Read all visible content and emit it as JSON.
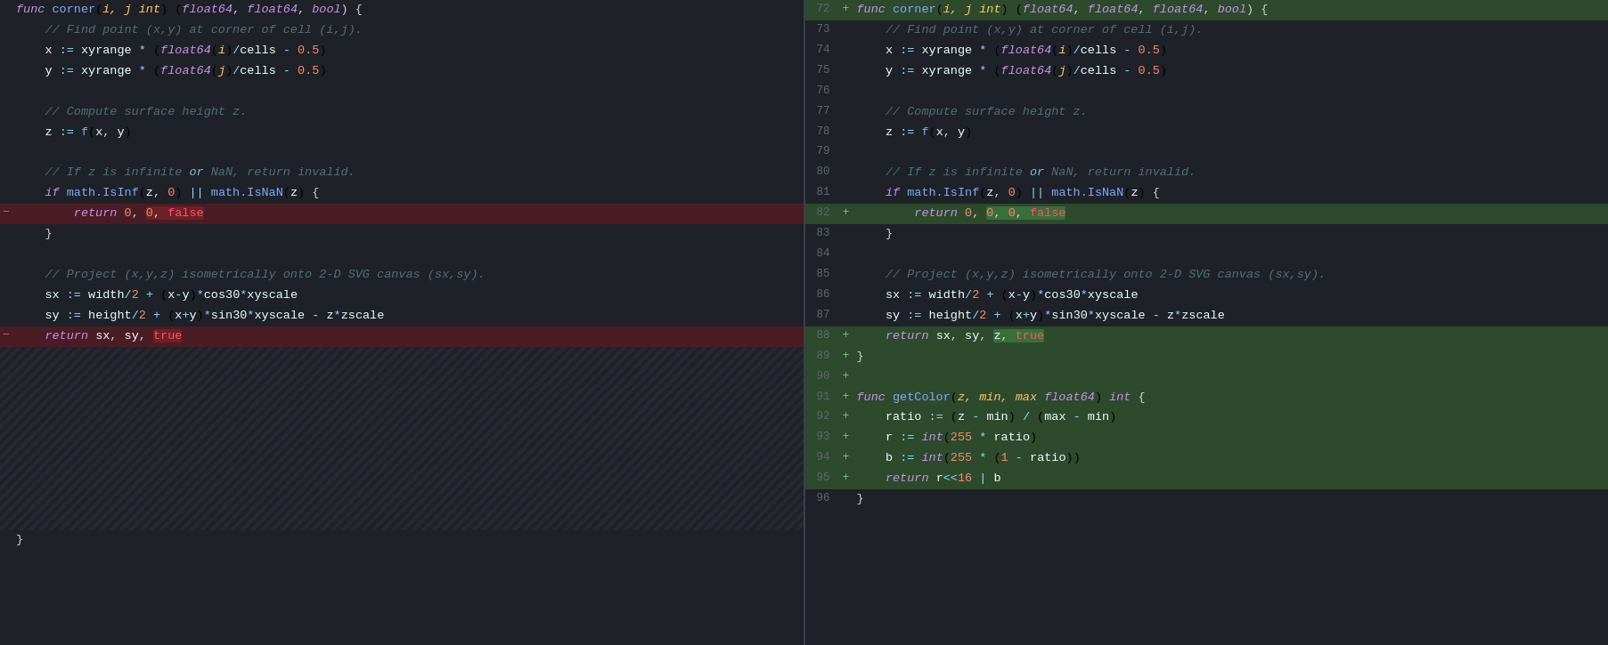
{
  "colors": {
    "bg": "#1e2228",
    "removed_bg": "#4a1c24",
    "added_bg": "#2d4a2d",
    "gutter_text": "#606672",
    "border": "#3a3f4b"
  },
  "left_pane": {
    "lines": [
      {
        "type": "normal",
        "content": "func_corner_header"
      },
      {
        "type": "normal",
        "content": "comment_find"
      },
      {
        "type": "normal",
        "content": "x_assign"
      },
      {
        "type": "normal",
        "content": "y_assign"
      },
      {
        "type": "normal",
        "content": "blank"
      },
      {
        "type": "normal",
        "content": "comment_compute"
      },
      {
        "type": "normal",
        "content": "z_assign"
      },
      {
        "type": "normal",
        "content": "blank"
      },
      {
        "type": "normal",
        "content": "comment_if_z"
      },
      {
        "type": "normal",
        "content": "if_math"
      },
      {
        "type": "removed",
        "content": "return_0_0_false"
      },
      {
        "type": "normal",
        "content": "close_brace"
      },
      {
        "type": "normal",
        "content": "blank"
      },
      {
        "type": "normal",
        "content": "comment_project"
      },
      {
        "type": "normal",
        "content": "sx_assign"
      },
      {
        "type": "normal",
        "content": "sy_assign"
      },
      {
        "type": "removed",
        "content": "return_sx_sy_true"
      },
      {
        "type": "hatch"
      },
      {
        "type": "hatch"
      },
      {
        "type": "hatch"
      },
      {
        "type": "hatch"
      },
      {
        "type": "hatch"
      },
      {
        "type": "hatch"
      },
      {
        "type": "hatch"
      },
      {
        "type": "hatch"
      },
      {
        "type": "hatch"
      },
      {
        "type": "hatch"
      },
      {
        "type": "normal",
        "content": "close_brace_end"
      }
    ]
  },
  "right_pane": {
    "lines": [
      {
        "num": "72",
        "diff": "+",
        "type": "normal",
        "content": "func_corner_header_new"
      },
      {
        "num": "73",
        "diff": " ",
        "type": "normal",
        "content": "comment_find"
      },
      {
        "num": "74",
        "diff": " ",
        "type": "normal",
        "content": "x_assign"
      },
      {
        "num": "75",
        "diff": " ",
        "type": "normal",
        "content": "y_assign"
      },
      {
        "num": "76",
        "diff": " ",
        "type": "normal",
        "content": "blank"
      },
      {
        "num": "77",
        "diff": " ",
        "type": "normal",
        "content": "comment_compute"
      },
      {
        "num": "78",
        "diff": " ",
        "type": "normal",
        "content": "z_assign"
      },
      {
        "num": "79",
        "diff": " ",
        "type": "normal",
        "content": "blank"
      },
      {
        "num": "80",
        "diff": " ",
        "type": "normal",
        "content": "comment_if_z"
      },
      {
        "num": "81",
        "diff": " ",
        "type": "normal",
        "content": "if_math"
      },
      {
        "num": "82",
        "diff": "+",
        "type": "added",
        "content": "return_0_0_0_false"
      },
      {
        "num": "83",
        "diff": " ",
        "type": "normal",
        "content": "close_brace"
      },
      {
        "num": "84",
        "diff": " ",
        "type": "normal",
        "content": "blank"
      },
      {
        "num": "85",
        "diff": " ",
        "type": "normal",
        "content": "comment_project"
      },
      {
        "num": "86",
        "diff": " ",
        "type": "normal",
        "content": "sx_assign"
      },
      {
        "num": "87",
        "diff": " ",
        "type": "normal",
        "content": "sy_assign"
      },
      {
        "num": "88",
        "diff": "+",
        "type": "added",
        "content": "return_sx_sy_z_true"
      },
      {
        "num": "89",
        "diff": "+",
        "type": "added",
        "content": "close_brace_add"
      },
      {
        "num": "90",
        "diff": "+",
        "type": "added",
        "content": "blank_add"
      },
      {
        "num": "91",
        "diff": "+",
        "type": "added",
        "content": "func_getcolor"
      },
      {
        "num": "92",
        "diff": "+",
        "type": "added",
        "content": "ratio_assign"
      },
      {
        "num": "93",
        "diff": "+",
        "type": "added",
        "content": "r_assign"
      },
      {
        "num": "94",
        "diff": "+",
        "type": "added",
        "content": "b_assign"
      },
      {
        "num": "95",
        "diff": "+",
        "type": "added",
        "content": "return_r_b"
      },
      {
        "num": "96",
        "diff": " ",
        "type": "normal",
        "content": "close_brace_end"
      }
    ]
  }
}
